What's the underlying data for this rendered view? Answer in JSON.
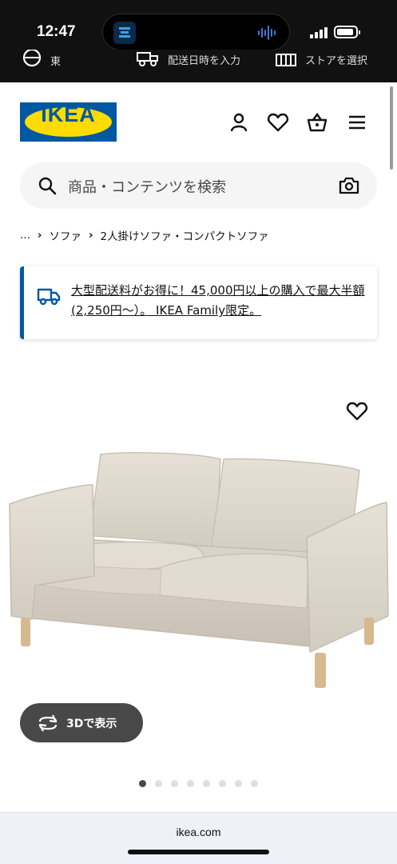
{
  "status": {
    "time": "12:47"
  },
  "utility": {
    "items": [
      "東",
      "配送日時を入力",
      "ストアを選択"
    ]
  },
  "header": {
    "logo": "IKEA",
    "icons": [
      "person-icon",
      "heart-icon",
      "basket-icon",
      "menu-icon"
    ]
  },
  "search": {
    "placeholder": "商品・コンテンツを検索"
  },
  "breadcrumb": {
    "ellipsis": "...",
    "items": [
      "ソファ",
      "2人掛けソファ・コンパクトソファ"
    ]
  },
  "promo": {
    "text": "大型配送料がお得に！45,000円以上の購入で最大半額(2,250円〜）。 IKEA Family限定。"
  },
  "product": {
    "view3d_label": "3Dで表示",
    "image_count": 8,
    "active_image": 1
  },
  "browser": {
    "url": "ikea.com"
  },
  "colors": {
    "brand_blue": "#0058a3",
    "brand_yellow": "#ffdb00",
    "dark": "#111111"
  }
}
